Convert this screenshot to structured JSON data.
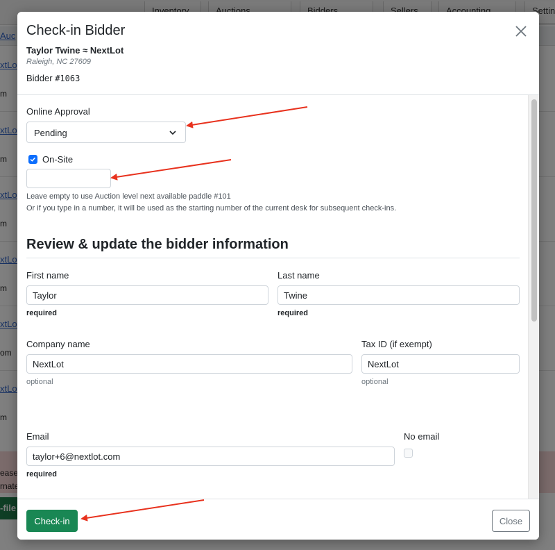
{
  "background": {
    "nav_tabs": [
      "Inventory",
      "Auctions",
      "Bidders",
      "Sellers",
      "Accounting",
      "Settings"
    ],
    "sub_link": "Auc",
    "row_links": [
      "xtLot",
      "xtLot",
      "xtLot",
      "xtLot",
      "xtLot",
      "xtLot"
    ],
    "row_suffixes": [
      "m",
      "m",
      "m",
      "m",
      "om",
      "m"
    ],
    "alert_lines": [
      "ease",
      "rnate"
    ],
    "green_button": "-file"
  },
  "modal": {
    "title": "Check-in Bidder",
    "bidder_name": "Taylor Twine",
    "bidder_separator": "≈",
    "bidder_company": "NextLot",
    "bidder_location": "Raleigh, NC 27609",
    "bidder_number_label": "Bidder",
    "bidder_number": "#1063"
  },
  "form": {
    "online_approval_label": "Online Approval",
    "online_approval_value": "Pending",
    "onsite_label": "On-Site",
    "onsite_checked": true,
    "paddle_value": "",
    "paddle_help_1": "Leave empty to use Auction level next available paddle #101",
    "paddle_help_2": "Or if you type in a number, it will be used as the starting number of the current desk for subsequent check-ins.",
    "section_title": "Review & update the bidder information",
    "first_name_label": "First name",
    "first_name_value": "Taylor",
    "first_name_hint": "required",
    "last_name_label": "Last name",
    "last_name_value": "Twine",
    "last_name_hint": "required",
    "company_label": "Company name",
    "company_value": "NextLot",
    "company_hint": "optional",
    "tax_label": "Tax ID (if exempt)",
    "tax_value": "NextLot",
    "tax_hint": "optional",
    "email_label": "Email",
    "email_value": "taylor+6@nextlot.com",
    "email_hint": "required",
    "no_email_label": "No email",
    "no_email_checked": false
  },
  "footer": {
    "checkin_label": "Check-in",
    "close_label": "Close"
  },
  "colors": {
    "primary_green": "#198754",
    "checkbox_blue": "#0d6efd",
    "annotation_red": "#e8321e"
  }
}
